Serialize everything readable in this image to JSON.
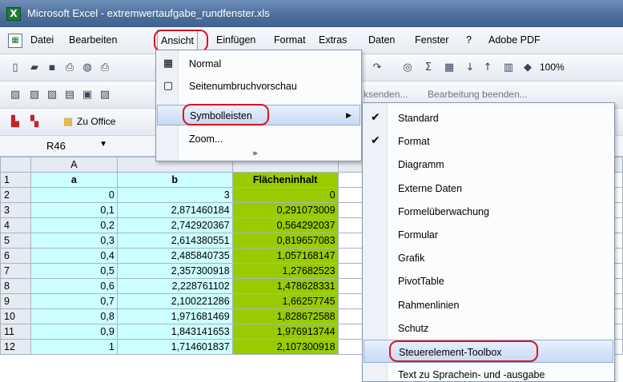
{
  "window": {
    "title": "Microsoft Excel - extremwertaufgabe_rundfenster.xls"
  },
  "menubar": {
    "items": [
      "Datei",
      "Bearbeiten",
      "Ansicht",
      "Einfügen",
      "Format",
      "Extras",
      "Daten",
      "Fenster",
      "?",
      "Adobe PDF"
    ]
  },
  "toolbar": {
    "zoom": "100%",
    "office_label": "Zu Office",
    "review_text": "ksenden...",
    "edit_end_text": "Bearbeitung beenden...",
    "sigma": "Σ"
  },
  "namebox": {
    "value": "R46"
  },
  "grid": {
    "columns": [
      "A"
    ],
    "headers": [
      "a",
      "b",
      "Flächeninhalt"
    ],
    "rows": [
      {
        "n": "1"
      },
      {
        "n": "2",
        "a": "0",
        "b": "3",
        "c": "0"
      },
      {
        "n": "3",
        "a": "0,1",
        "b": "2,871460184",
        "c": "0,291073009"
      },
      {
        "n": "4",
        "a": "0,2",
        "b": "2,742920367",
        "c": "0,564292037"
      },
      {
        "n": "5",
        "a": "0,3",
        "b": "2,614380551",
        "c": "0,819657083"
      },
      {
        "n": "6",
        "a": "0,4",
        "b": "2,485840735",
        "c": "1,057168147"
      },
      {
        "n": "7",
        "a": "0,5",
        "b": "2,357300918",
        "c": "1,27682523"
      },
      {
        "n": "8",
        "a": "0,6",
        "b": "2,228761102",
        "c": "1,478628331"
      },
      {
        "n": "9",
        "a": "0,7",
        "b": "2,100221286",
        "c": "1,66257745"
      },
      {
        "n": "10",
        "a": "0,8",
        "b": "1,971681469",
        "c": "1,828672588"
      },
      {
        "n": "11",
        "a": "0,9",
        "b": "1,843141653",
        "c": "1,976913744"
      },
      {
        "n": "12",
        "a": "1",
        "b": "1,714601837",
        "c": "2,107300918"
      }
    ]
  },
  "view_menu": {
    "items": [
      {
        "label": "Normal"
      },
      {
        "label": "Seitenumbruchvorschau"
      },
      {
        "label": "Symbolleisten"
      },
      {
        "label": "Zoom..."
      }
    ],
    "more": "»"
  },
  "toolbars_submenu": {
    "items": [
      {
        "label": "Standard",
        "checked": true
      },
      {
        "label": "Format",
        "checked": true
      },
      {
        "label": "Diagramm",
        "checked": false
      },
      {
        "label": "Externe Daten",
        "checked": false
      },
      {
        "label": "Formelüberwachung",
        "checked": false
      },
      {
        "label": "Formular",
        "checked": false
      },
      {
        "label": "Grafik",
        "checked": false
      },
      {
        "label": "PivotTable",
        "checked": false
      },
      {
        "label": "Rahmenlinien",
        "checked": false
      },
      {
        "label": "Schutz",
        "checked": false
      },
      {
        "label": "Steuerelement-Toolbox",
        "checked": false
      },
      {
        "label": "Text zu Sprachein- und -ausgabe",
        "checked": false
      }
    ]
  },
  "colors": {
    "highlight_circle": "#d9161b",
    "cell_blue": "#ccffff",
    "cell_green": "#99cc00"
  }
}
